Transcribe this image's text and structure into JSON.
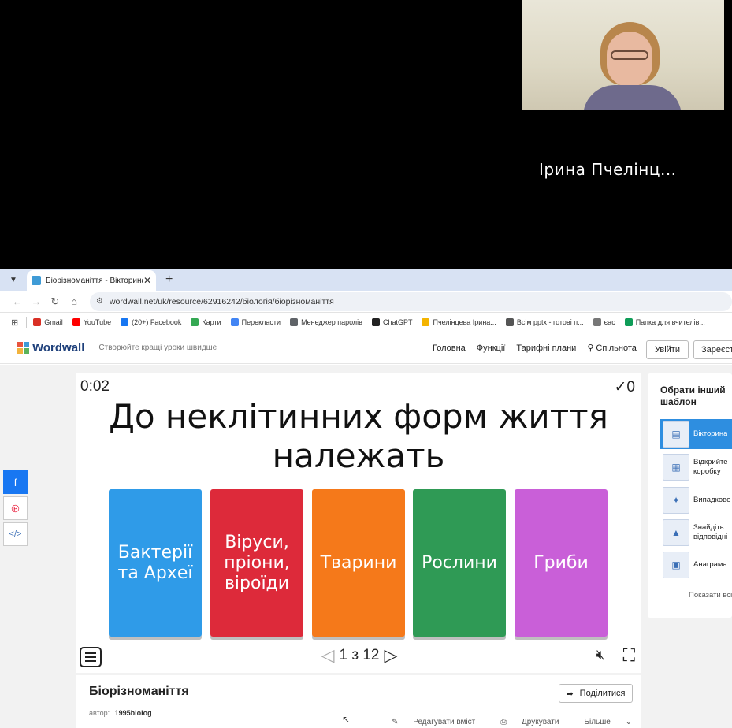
{
  "video_call": {
    "participant_name": "Ірина Пчелінц..."
  },
  "browser": {
    "tab_title": "Біорізноманіття - Вікторина",
    "tab_close": "✕",
    "new_tab": "+",
    "url": "wordwall.net/uk/resource/62916242/біологія/біорізноманіття",
    "bookmarks": [
      {
        "label": "Gmail",
        "color": "#d93025"
      },
      {
        "label": "YouTube",
        "color": "#ff0000"
      },
      {
        "label": "(20+) Facebook",
        "color": "#1877f2"
      },
      {
        "label": "Карти",
        "color": "#34a853"
      },
      {
        "label": "Перекласти",
        "color": "#4285f4"
      },
      {
        "label": "Менеджер паролів",
        "color": "#5f6368"
      },
      {
        "label": "ChatGPT",
        "color": "#222222"
      },
      {
        "label": "Пчелінцева Ірина...",
        "color": "#f4b400"
      },
      {
        "label": "Всім pptx - готові п...",
        "color": "#555555"
      },
      {
        "label": "єас",
        "color": "#777777"
      },
      {
        "label": "Папка для вчителів...",
        "color": "#0f9d58"
      }
    ]
  },
  "wordwall": {
    "logo_text": "Wordwall",
    "tagline": "Створюйте кращі уроки швидше",
    "nav": [
      "Головна",
      "Функції",
      "Тарифні плани",
      "Спільнота"
    ],
    "login_label": "Увійти",
    "signup_label": "Зареєстр",
    "brand_colors": [
      "#e8543f",
      "#3f9bd6",
      "#f2b33d",
      "#5bb35a"
    ]
  },
  "game": {
    "timer": "0:02",
    "score": "✓0",
    "question": "До неклітинних форм життя належать",
    "answers": [
      {
        "label": "Бактерії та Археї",
        "color": "#2f9be8"
      },
      {
        "label": "Віруси, пріони, віроїди",
        "color": "#dd2a3a"
      },
      {
        "label": "Тварини",
        "color": "#f5791a"
      },
      {
        "label": "Рослини",
        "color": "#2f9a55"
      },
      {
        "label": "Гриби",
        "color": "#c95fd8"
      }
    ],
    "page_indicator": "1 з 12"
  },
  "side_panel": {
    "title": "Обрати інший шаблон",
    "templates": [
      {
        "label": "Вікторина",
        "active": true
      },
      {
        "label": "Відкрийте коробку",
        "active": false
      },
      {
        "label": "Випадкове",
        "active": false
      },
      {
        "label": "Знайдіть відповідні",
        "active": false
      },
      {
        "label": "Анаграма",
        "active": false
      }
    ],
    "show_all": "Показати всі"
  },
  "info": {
    "title": "Біорізноманіття",
    "share_label": "Поділитися",
    "author_label": "автор:",
    "author": "1995biolog",
    "edit_label": "Редагувати вміст",
    "print_label": "Друкувати",
    "more_label": "Більше"
  }
}
